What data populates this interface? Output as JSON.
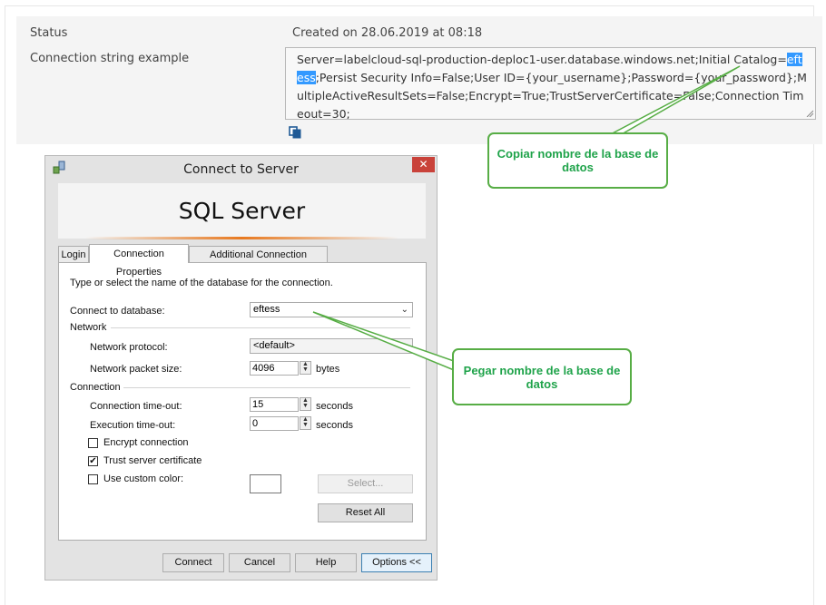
{
  "properties": {
    "status_label": "Status",
    "status_value": "Created on 28.06.2019 at 08:18",
    "conn_label": "Connection string example",
    "conn_before": "Server=labelcloud-sql-production-deploc1-user.database.windows.net;Initial Catalog=",
    "conn_highlight": "eftess",
    "conn_after": ";Persist Security Info=False;User ID={your_username};Password={your_password};MultipleActiveResultSets=False;Encrypt=True;TrustServerCertificate=False;Connection Timeout=30;"
  },
  "callouts": {
    "copy": "Copiar nombre de la base de datos",
    "paste": "Pegar nombre de la base de datos"
  },
  "dialog": {
    "title": "Connect to Server",
    "banner": "SQL Server",
    "close_glyph": "✕",
    "tabs": [
      "Login",
      "Connection Properties",
      "Additional Connection Parameters"
    ],
    "instruction": "Type or select the name of the database for the connection.",
    "connect_db_label": "Connect to database:",
    "connect_db_value": "eftess",
    "network_section": "Network",
    "network_protocol_label": "Network protocol:",
    "network_protocol_value": "<default>",
    "packet_size_label": "Network packet size:",
    "packet_size_value": "4096",
    "packet_size_unit": "bytes",
    "connection_section": "Connection",
    "conn_timeout_label": "Connection time-out:",
    "conn_timeout_value": "15",
    "conn_timeout_unit": "seconds",
    "exec_timeout_label": "Execution time-out:",
    "exec_timeout_value": "0",
    "exec_timeout_unit": "seconds",
    "encrypt_label": "Encrypt connection",
    "encrypt_checked": false,
    "trust_label": "Trust server certificate",
    "trust_checked": true,
    "custom_color_label": "Use custom color:",
    "custom_color_checked": false,
    "select_button": "Select...",
    "reset_button": "Reset All",
    "connect_button": "Connect",
    "cancel_button": "Cancel",
    "help_button": "Help",
    "options_button": "Options <<",
    "check_glyph": "✔"
  },
  "colors": {
    "callout_border": "#57ad45",
    "callout_text": "#1fa34a",
    "highlight": "#3399ff",
    "close_button": "#c9423a"
  }
}
